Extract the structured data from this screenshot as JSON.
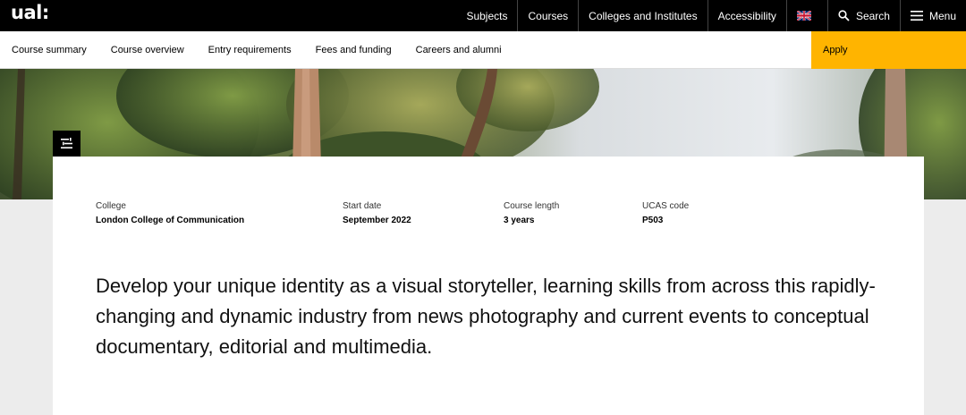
{
  "header": {
    "logo": "ual:",
    "nav": [
      {
        "label": "Subjects"
      },
      {
        "label": "Courses"
      },
      {
        "label": "Colleges and Institutes"
      },
      {
        "label": "Accessibility"
      }
    ],
    "language_icon": "uk-flag-icon",
    "search_label": "Search",
    "menu_label": "Menu"
  },
  "subnav": {
    "links": [
      "Course summary",
      "Course overview",
      "Entry requirements",
      "Fees and funding",
      "Careers and alumni"
    ],
    "apply_label": "Apply"
  },
  "colors": {
    "apply_accent": "#ffb400",
    "topbar": "#000000"
  },
  "course_facts": [
    {
      "label": "College",
      "value": "London College of Communication"
    },
    {
      "label": "Start date",
      "value": "September 2022"
    },
    {
      "label": "Course length",
      "value": "3 years"
    },
    {
      "label": "UCAS code",
      "value": "P503"
    }
  ],
  "intro_text": "Develop your unique identity as a visual storyteller, learning skills from across this rapidly-changing and dynamic industry from news photography and current events to conceptual documentary, editorial and multimedia."
}
